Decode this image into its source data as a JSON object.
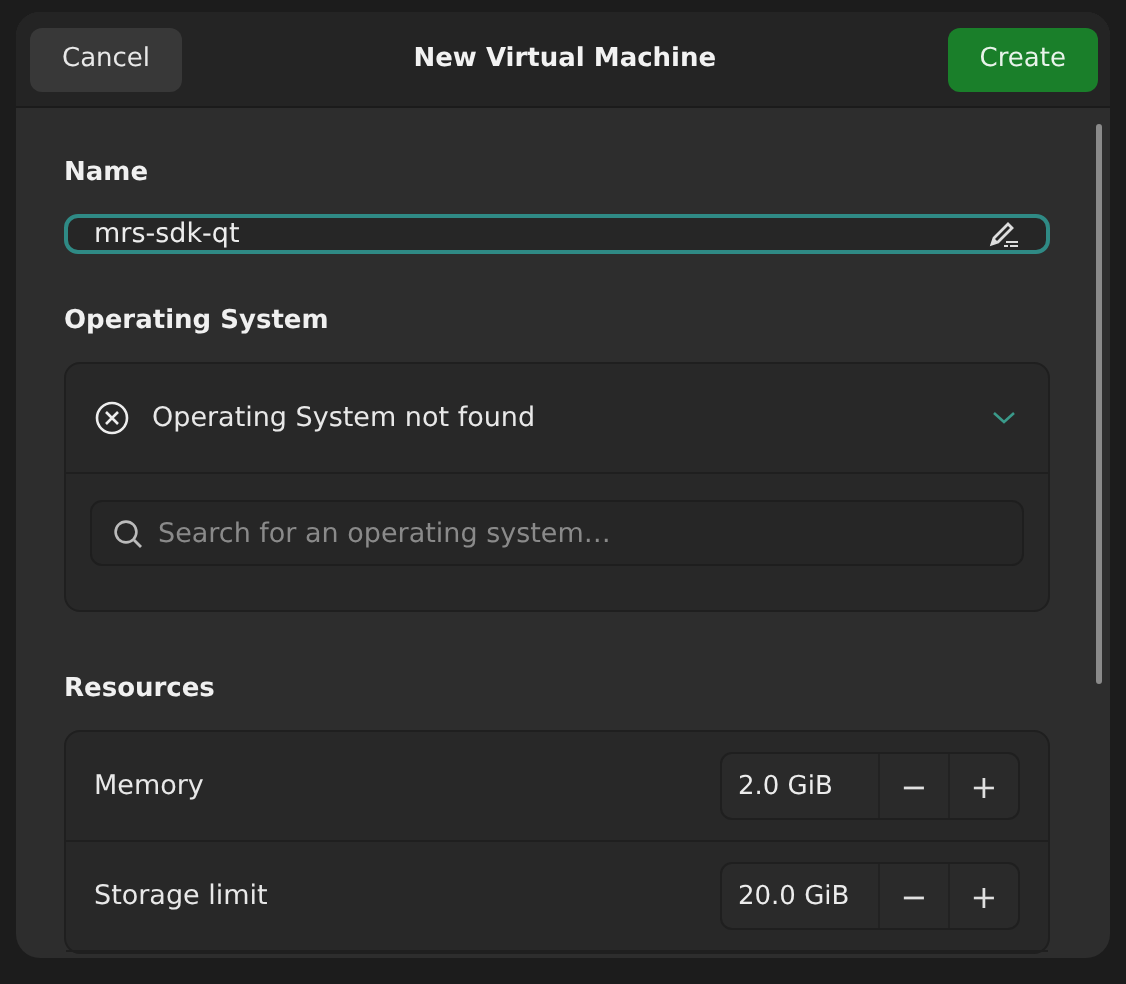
{
  "window": {
    "title": "New Virtual Machine"
  },
  "header": {
    "cancel": "Cancel",
    "create": "Create"
  },
  "name_section": {
    "heading": "Name",
    "value": "mrs-sdk-qt"
  },
  "os_section": {
    "heading": "Operating System",
    "status": "Operating System not found",
    "expanded": true,
    "search": {
      "placeholder": "Search for an operating system…"
    }
  },
  "resources": {
    "heading": "Resources",
    "rows": [
      {
        "label": "Memory",
        "value": "2.0 GiB",
        "decrement": "−",
        "increment": "+"
      },
      {
        "label": "Storage limit",
        "value": "20.0 GiB",
        "decrement": "−",
        "increment": "+"
      }
    ]
  }
}
